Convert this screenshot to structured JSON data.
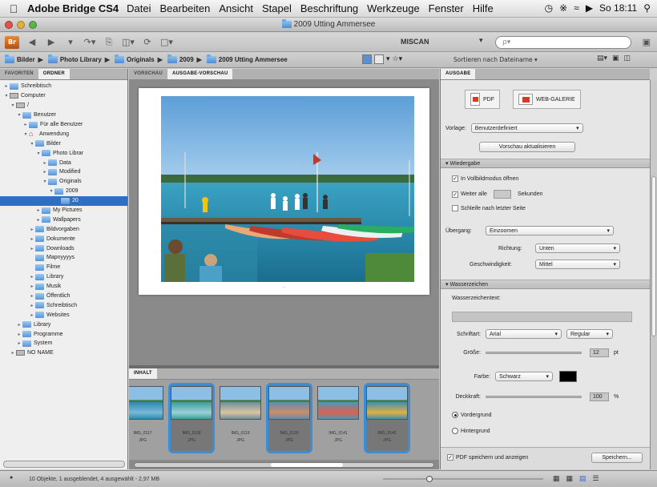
{
  "menubar": {
    "app_name": "Adobe Bridge CS4",
    "items": [
      "Datei",
      "Bearbeiten",
      "Ansicht",
      "Stapel",
      "Beschriftung",
      "Werkzeuge",
      "Fenster",
      "Hilfe"
    ],
    "clock": "So 18:11"
  },
  "window": {
    "title": "2009 Utting Ammersee"
  },
  "toolbar": {
    "workspace": "MISCAN",
    "search_placeholder": "ρ▾"
  },
  "path": {
    "crumbs": [
      "Bilder",
      "Photo Library",
      "Originals",
      "2009",
      "2009 Utting Ammersee"
    ],
    "sort_label": "Sortieren nach Dateiname ▾"
  },
  "left_panel": {
    "tabs": [
      "Favoriten",
      "Ordner"
    ],
    "tree": [
      {
        "indent": 0,
        "tw": "▸",
        "icon": "folder",
        "label": "Schreibtisch"
      },
      {
        "indent": 0,
        "tw": "▾",
        "icon": "hdd",
        "label": "Computer"
      },
      {
        "indent": 1,
        "tw": "▾",
        "icon": "hdd",
        "label": "/"
      },
      {
        "indent": 2,
        "tw": "▾",
        "icon": "folder",
        "label": "Benutzer"
      },
      {
        "indent": 3,
        "tw": "▸",
        "icon": "folder",
        "label": "Für alle Benutzer"
      },
      {
        "indent": 3,
        "tw": "▾",
        "icon": "home",
        "label": "Anwendung"
      },
      {
        "indent": 4,
        "tw": "▾",
        "icon": "folder",
        "label": "Bilder"
      },
      {
        "indent": 5,
        "tw": "▾",
        "icon": "folder",
        "label": "Photo Librar"
      },
      {
        "indent": 6,
        "tw": "▸",
        "icon": "folder",
        "label": "Data"
      },
      {
        "indent": 6,
        "tw": "▸",
        "icon": "folder",
        "label": "Modified"
      },
      {
        "indent": 6,
        "tw": "▾",
        "icon": "folder",
        "label": "Originals"
      },
      {
        "indent": 7,
        "tw": "▾",
        "icon": "folder",
        "label": "2009"
      },
      {
        "indent": 8,
        "tw": "",
        "icon": "folder",
        "label": "20",
        "selected": true
      },
      {
        "indent": 5,
        "tw": "▸",
        "icon": "folder",
        "label": "My Pictures"
      },
      {
        "indent": 5,
        "tw": "▸",
        "icon": "folder",
        "label": "Wallpapers"
      },
      {
        "indent": 4,
        "tw": "▸",
        "icon": "folder",
        "label": "Bildvorgaben"
      },
      {
        "indent": 4,
        "tw": "▸",
        "icon": "folder",
        "label": "Dokumente"
      },
      {
        "indent": 4,
        "tw": "▸",
        "icon": "folder",
        "label": "Downloads"
      },
      {
        "indent": 4,
        "tw": "",
        "icon": "folder",
        "label": "Mapnyyyys"
      },
      {
        "indent": 4,
        "tw": "",
        "icon": "folder",
        "label": "Filme"
      },
      {
        "indent": 4,
        "tw": "▸",
        "icon": "folder",
        "label": "Library"
      },
      {
        "indent": 4,
        "tw": "▸",
        "icon": "folder",
        "label": "Musik"
      },
      {
        "indent": 4,
        "tw": "▸",
        "icon": "folder",
        "label": "Öffentlich"
      },
      {
        "indent": 4,
        "tw": "▸",
        "icon": "folder",
        "label": "Schreibtisch"
      },
      {
        "indent": 4,
        "tw": "▸",
        "icon": "folder",
        "label": "Websites"
      },
      {
        "indent": 2,
        "tw": "▸",
        "icon": "folder",
        "label": "Library"
      },
      {
        "indent": 2,
        "tw": "▸",
        "icon": "folder",
        "label": "Programme"
      },
      {
        "indent": 2,
        "tw": "▸",
        "icon": "folder",
        "label": "System"
      },
      {
        "indent": 1,
        "tw": "▸",
        "icon": "hdd",
        "label": "NO NAME"
      }
    ]
  },
  "center": {
    "tabs": [
      "Vorschau",
      "Ausgabe-Vorschau"
    ],
    "filmstrip_tab": "Inhalt",
    "thumbnails": [
      {
        "name": "IMG_0117",
        "type": "JPG",
        "selected": false
      },
      {
        "name": "IMG_0118",
        "type": "JPG",
        "selected": true
      },
      {
        "name": "IMG_0119",
        "type": "JPG",
        "selected": false
      },
      {
        "name": "IMG_0120",
        "type": "JPG",
        "selected": true
      },
      {
        "name": "IMG_0141",
        "type": "JPG",
        "selected": false
      },
      {
        "name": "IMG_0142",
        "type": "JPG",
        "selected": true
      }
    ]
  },
  "right_panel": {
    "tab": "Ausgabe",
    "pdf_label": "PDF",
    "web_label": "WEB-GALERIE",
    "template_label": "Vorlage:",
    "template_value": "Benutzerdefiniert",
    "refresh_button": "Vorschau aktualisieren",
    "section_playback": "Wiedergabe",
    "fullscreen_label": "In Vollbildmodus öffnen",
    "advance_label": "Weiter alle",
    "advance_value": "",
    "seconds_label": "Sekunden",
    "loop_label": "Schleife nach letzter Seite",
    "transition_label": "Übergang:",
    "transition_value": "Einzoomen",
    "direction_label": "Richtung:",
    "direction_value": "Unten",
    "speed_label": "Geschwindigkeit:",
    "speed_value": "Mittel",
    "section_watermark": "Wasserzeichen",
    "watermark_text_label": "Wasserzeichentext:",
    "font_label": "Schriftart:",
    "font_value": "Arial",
    "style_value": "Regular",
    "size_label": "Größe:",
    "size_value": "12",
    "size_unit": "pt",
    "color_label": "Farbe:",
    "color_value": "Schwarz",
    "opacity_label": "Deckkraft:",
    "opacity_value": "100",
    "opacity_unit": "%",
    "foreground_label": "Vordergrund",
    "background_label": "Hintergrund",
    "save_show_label": "PDF speichern und anzeigen",
    "save_button": "Speichern..."
  },
  "status": {
    "text": "10 Objekte, 1 ausgeblendet, 4 ausgewählt - 2,97 MB"
  },
  "colors": {
    "selection": "#2f6fc3",
    "thumb_border": "#3a8ed8"
  }
}
